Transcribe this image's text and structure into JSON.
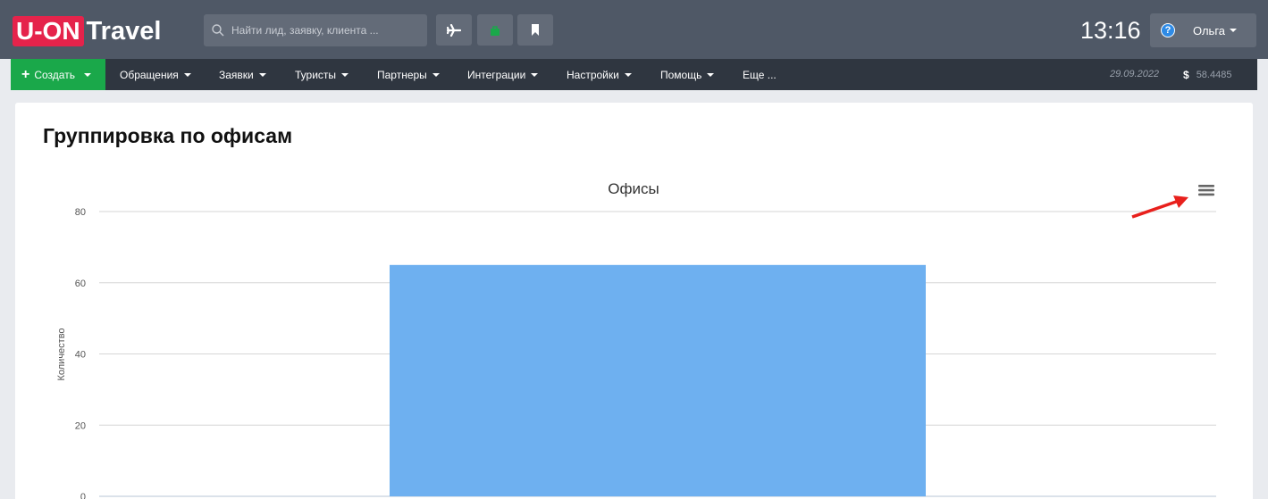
{
  "header": {
    "logo": {
      "box_text": "U-ON",
      "text": "Travel"
    },
    "search": {
      "placeholder": "Найти лид, заявку, клиента ..."
    },
    "clock": "13:16",
    "user": {
      "name": "Ольга"
    }
  },
  "nav": {
    "create_label": "Создать",
    "items": [
      {
        "label": "Обращения"
      },
      {
        "label": "Заявки"
      },
      {
        "label": "Туристы"
      },
      {
        "label": "Партнеры"
      },
      {
        "label": "Интеграции"
      },
      {
        "label": "Настройки"
      },
      {
        "label": "Помощь"
      },
      {
        "label": "Еще ..."
      }
    ],
    "date": "29.09.2022",
    "currency_symbol": "$",
    "rate": "58.4485"
  },
  "page": {
    "title": "Группировка по офисам"
  },
  "chart_data": {
    "type": "bar",
    "title": "Офисы",
    "ylabel": "Количество",
    "xlabel": "",
    "categories": [
      ""
    ],
    "values": [
      65
    ],
    "ylim": [
      0,
      80
    ],
    "yticks": [
      0,
      20,
      40,
      60,
      80
    ],
    "grid": true,
    "bar_color": "#6eb0f0"
  },
  "colors": {
    "header_bg": "#4f5866",
    "nav_bg": "#2f3640",
    "create_green": "#1aa84a",
    "logo_red": "#e5234b",
    "annotation_arrow": "#e8201c"
  }
}
